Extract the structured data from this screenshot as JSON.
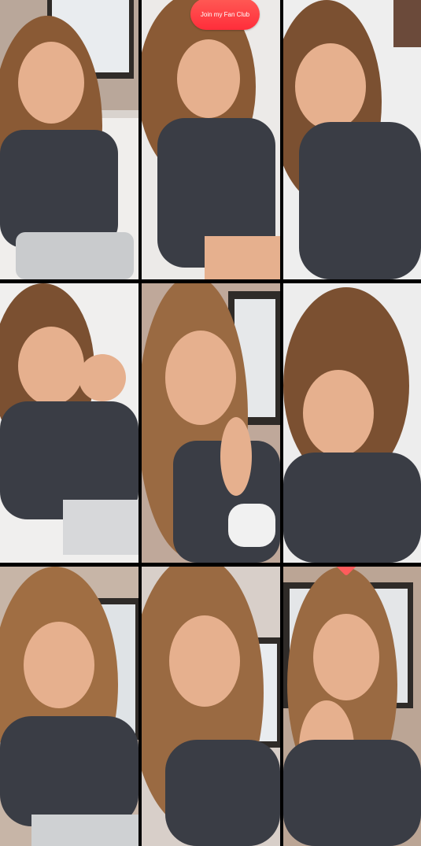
{
  "collage": {
    "fan_club_badge": "Join my Fan Club",
    "tiles": [
      {
        "name": "tile-1",
        "scene": "bed"
      },
      {
        "name": "tile-2",
        "scene": "bed"
      },
      {
        "name": "tile-3",
        "scene": "bed"
      },
      {
        "name": "tile-4",
        "scene": "bed"
      },
      {
        "name": "tile-5",
        "scene": "window"
      },
      {
        "name": "tile-6",
        "scene": "bed"
      },
      {
        "name": "tile-7",
        "scene": "room"
      },
      {
        "name": "tile-8",
        "scene": "room"
      },
      {
        "name": "tile-9",
        "scene": "window"
      }
    ],
    "colors": {
      "background": "#000000",
      "badge": "#ff3340",
      "shirt": "#3a3d45",
      "hair": "#8a5a35",
      "skin": "#e6b08e"
    }
  }
}
